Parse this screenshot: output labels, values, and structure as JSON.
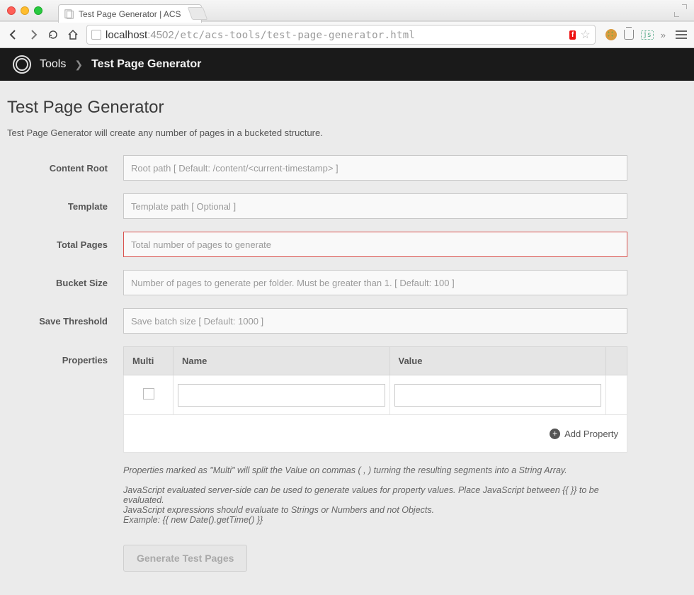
{
  "window": {
    "tab_title": "Test Page Generator | ACS"
  },
  "url": {
    "host": "localhost",
    "port": ":4502",
    "path": "/etc/acs-tools/test-page-generator.html",
    "flash_badge": "f"
  },
  "breadcrumb": {
    "root": "Tools",
    "current": "Test Page Generator"
  },
  "page": {
    "title": "Test Page Generator",
    "description": "Test Page Generator will create any number of pages in a bucketed structure."
  },
  "fields": {
    "content_root": {
      "label": "Content Root",
      "placeholder": "Root path [ Default: /content/<current-timestamp> ]"
    },
    "template": {
      "label": "Template",
      "placeholder": "Template path [ Optional ]"
    },
    "total_pages": {
      "label": "Total Pages",
      "placeholder": "Total number of pages to generate"
    },
    "bucket_size": {
      "label": "Bucket Size",
      "placeholder": "Number of pages to generate per folder. Must be greater than 1. [ Default: 100 ]"
    },
    "save_threshold": {
      "label": "Save Threshold",
      "placeholder": "Save batch size [ Default: 1000 ]"
    },
    "properties": {
      "label": "Properties"
    }
  },
  "properties_table": {
    "headers": {
      "multi": "Multi",
      "name": "Name",
      "value": "Value"
    },
    "add_label": "Add Property"
  },
  "hints": {
    "multi": "Properties marked as \"Multi\" will split the Value on commas ( , ) turning the resulting segments into a String Array.",
    "js1": "JavaScript evaluated server-side can be used to generate values for property values. Place JavaScript between {{ }} to be evaluated.",
    "js2": "JavaScript expressions should evaluate to Strings or Numbers and not Objects.",
    "js3": "Example: {{ new Date().getTime() }}"
  },
  "buttons": {
    "generate": "Generate Test Pages"
  }
}
